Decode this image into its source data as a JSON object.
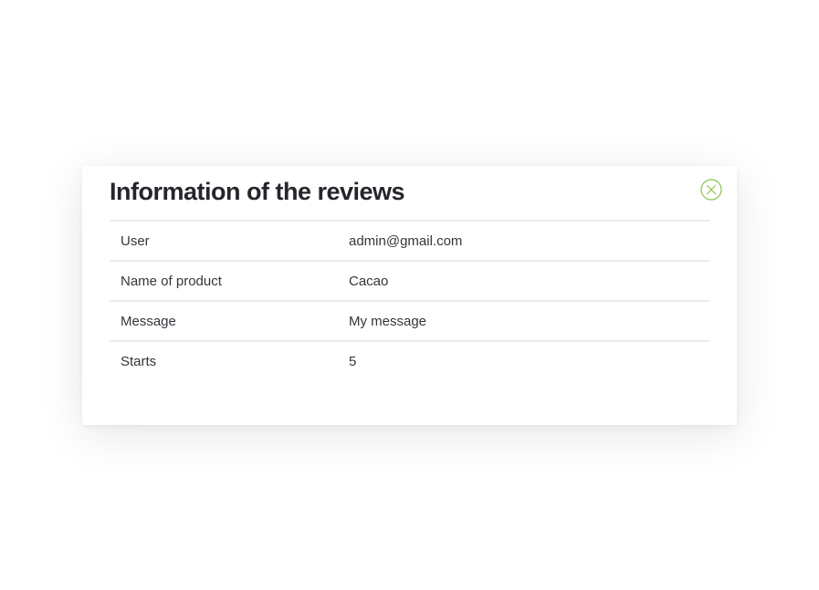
{
  "modal": {
    "title": "Information of the reviews",
    "close_icon": "close-circle-icon",
    "accent_color": "#8bc34a",
    "rows": [
      {
        "label": "User",
        "value": "admin@gmail.com"
      },
      {
        "label": "Name of product",
        "value": "Cacao"
      },
      {
        "label": "Message",
        "value": "My message"
      },
      {
        "label": "Starts",
        "value": "5"
      }
    ]
  }
}
